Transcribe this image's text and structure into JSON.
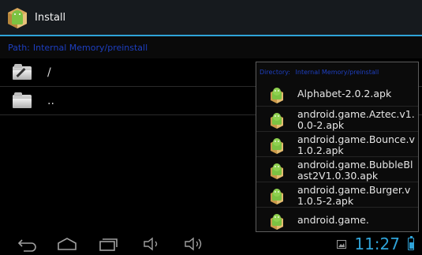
{
  "action_bar": {
    "title": "Install",
    "logo_icon": "android-package-icon"
  },
  "path_bar": {
    "label": "Path:",
    "value": "Internal Memory/preinstall"
  },
  "directory_list": {
    "items": [
      {
        "name": "/",
        "icon": "folder-edit-icon"
      },
      {
        "name": "..",
        "icon": "folder-up-icon"
      }
    ]
  },
  "popup": {
    "title_label": "Directory:",
    "title_value": "Internal Memory/preinstall",
    "items": [
      {
        "name": "Alphabet-2.0.2.apk",
        "icon": "apk-icon"
      },
      {
        "name": "android.game.Aztec.v1.0.0-2.apk",
        "icon": "apk-icon"
      },
      {
        "name": "android.game.Bounce.v1.0.2.apk",
        "icon": "apk-icon"
      },
      {
        "name": "android.game.BubbleBlast2V1.0.30.apk",
        "icon": "apk-icon"
      },
      {
        "name": "android.game.Burger.v1.0.5-2.apk",
        "icon": "apk-icon"
      },
      {
        "name": "android.game.",
        "icon": "apk-icon"
      }
    ]
  },
  "nav_bar": {
    "buttons": [
      "back-icon",
      "home-icon",
      "recent-apps-icon",
      "volume-down-icon",
      "volume-up-icon"
    ]
  },
  "status": {
    "time": "11:27",
    "battery_level": 0.6
  },
  "colors": {
    "accent": "#2fa3d8",
    "path_text": "#1e3fc0",
    "background": "#000000"
  }
}
